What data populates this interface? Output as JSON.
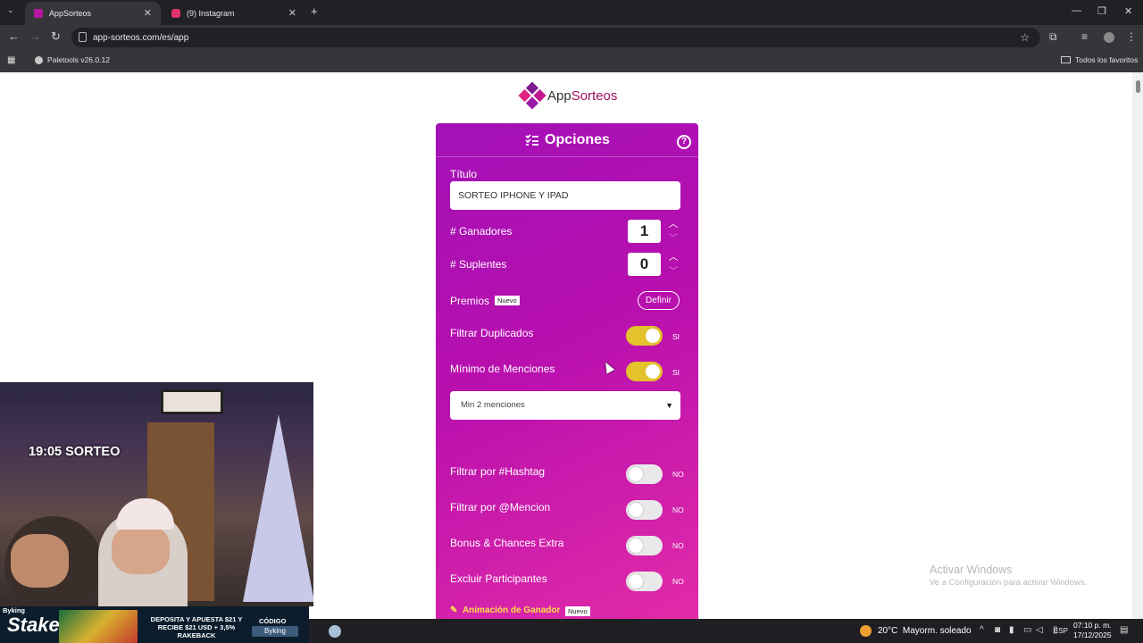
{
  "browser": {
    "tabs": [
      {
        "label": "AppSorteos",
        "favicon_color": "#b5179e"
      },
      {
        "label": "(9) Instagram",
        "favicon_color": "#e1306c"
      }
    ],
    "url": "app-sorteos.com/es/app",
    "bookmarks": {
      "item": "Paletools v26.0.12",
      "all_label": "Todos los favoritos"
    }
  },
  "logo": {
    "part1": "App",
    "part2": "Sorteos"
  },
  "panel": {
    "title": "Opciones",
    "help": "?",
    "titulo_label": "Título",
    "titulo_value": "SORTEO IPHONE Y IPAD",
    "ganadores_label": "# Ganadores",
    "ganadores_value": "1",
    "suplentes_label": "# Suplentes",
    "suplentes_value": "0",
    "premios_label": "Premios",
    "premios_badge": "Nuevo",
    "definir_button": "Definir",
    "toggles": [
      {
        "label": "Filtrar Duplicados",
        "state": "SI",
        "on": true
      },
      {
        "label": "Mínimo de Menciones",
        "state": "SI",
        "on": true
      },
      {
        "label": "Filtrar por #Hashtag",
        "state": "NO",
        "on": false
      },
      {
        "label": "Filtrar por @Mencion",
        "state": "NO",
        "on": false
      },
      {
        "label": "Bonus & Chances Extra",
        "state": "NO",
        "on": false
      },
      {
        "label": "Excluir Participantes",
        "state": "NO",
        "on": false
      }
    ],
    "menciones_select": "Min 2 menciones",
    "animacion_label": "Animación de Ganador",
    "animacion_badge": "Nuevo"
  },
  "watermark": {
    "line1": "Activar Windows",
    "line2": "Ve a Configuración para activar Windows."
  },
  "stream": {
    "overlay_text": "19:05 SORTEO",
    "username": "Byking",
    "brand": "Stake",
    "promo": "DEPOSITA Y APUESTA $21 Y RECIBE $21 USD + 3,5% RAKEBACK",
    "code_label": "CÓDIGO",
    "code_value": "Byking"
  },
  "taskbar": {
    "weather_temp": "20°C",
    "weather_text": "Mayorm. soleado",
    "lang": "ESP",
    "time": "07:10 p. m.",
    "date": "17/12/2025"
  }
}
